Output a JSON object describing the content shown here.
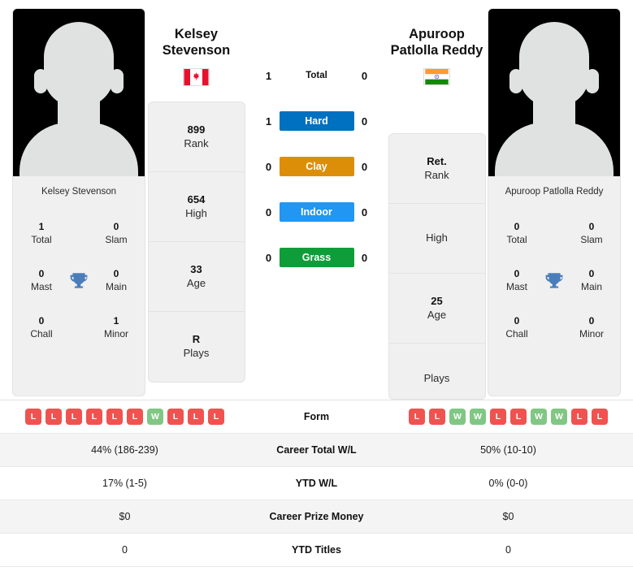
{
  "colors": {
    "hard": "#0070c0",
    "clay": "#dd8e09",
    "indoor": "#2196f3",
    "grass": "#0f9d3a",
    "win": "#81c784",
    "loss": "#ef5350",
    "trophy": "#4a7ebb"
  },
  "player_left": {
    "name_line1": "Kelsey",
    "name_line2": "Stevenson",
    "photo_caption": "Kelsey Stevenson",
    "flag": "canada-flag",
    "titles": {
      "total_value": "1",
      "total_label": "Total",
      "slam_value": "0",
      "slam_label": "Slam",
      "mast_value": "0",
      "mast_label": "Mast",
      "main_value": "0",
      "main_label": "Main",
      "chall_value": "0",
      "chall_label": "Chall",
      "minor_value": "1",
      "minor_label": "Minor"
    },
    "card": [
      {
        "value": "899",
        "label": "Rank"
      },
      {
        "value": "654",
        "label": "High"
      },
      {
        "value": "33",
        "label": "Age"
      },
      {
        "value": "R",
        "label": "Plays"
      }
    ],
    "form": [
      "L",
      "L",
      "L",
      "L",
      "L",
      "L",
      "W",
      "L",
      "L",
      "L"
    ]
  },
  "player_right": {
    "name_line1": "Apuroop",
    "name_line2": "Patlolla Reddy",
    "photo_caption": "Apuroop Patlolla Reddy",
    "flag": "india-flag",
    "titles": {
      "total_value": "0",
      "total_label": "Total",
      "slam_value": "0",
      "slam_label": "Slam",
      "mast_value": "0",
      "mast_label": "Mast",
      "main_value": "0",
      "main_label": "Main",
      "chall_value": "0",
      "chall_label": "Chall",
      "minor_value": "0",
      "minor_label": "Minor"
    },
    "card": [
      {
        "value": "Ret.",
        "label": "Rank"
      },
      {
        "value": "",
        "label": "High"
      },
      {
        "value": "25",
        "label": "Age"
      },
      {
        "value": "",
        "label": "Plays"
      }
    ],
    "form": [
      "L",
      "L",
      "W",
      "W",
      "L",
      "L",
      "W",
      "W",
      "L",
      "L"
    ]
  },
  "surfaces": [
    {
      "label": "Total",
      "left": "1",
      "right": "0",
      "style": "plain",
      "key": "total"
    },
    {
      "label": "Hard",
      "left": "1",
      "right": "0",
      "style": "filled",
      "key": "hard"
    },
    {
      "label": "Clay",
      "left": "0",
      "right": "0",
      "style": "filled",
      "key": "clay"
    },
    {
      "label": "Indoor",
      "left": "0",
      "right": "0",
      "style": "filled",
      "key": "indoor"
    },
    {
      "label": "Grass",
      "left": "0",
      "right": "0",
      "style": "filled",
      "key": "grass"
    }
  ],
  "table": {
    "form_label": "Form",
    "rows": [
      {
        "label": "Career Total W/L",
        "left": "44% (186-239)",
        "right": "50% (10-10)"
      },
      {
        "label": "YTD W/L",
        "left": "17% (1-5)",
        "right": "0% (0-0)"
      },
      {
        "label": "Career Prize Money",
        "left": "$0",
        "right": "$0"
      },
      {
        "label": "YTD Titles",
        "left": "0",
        "right": "0"
      }
    ]
  }
}
